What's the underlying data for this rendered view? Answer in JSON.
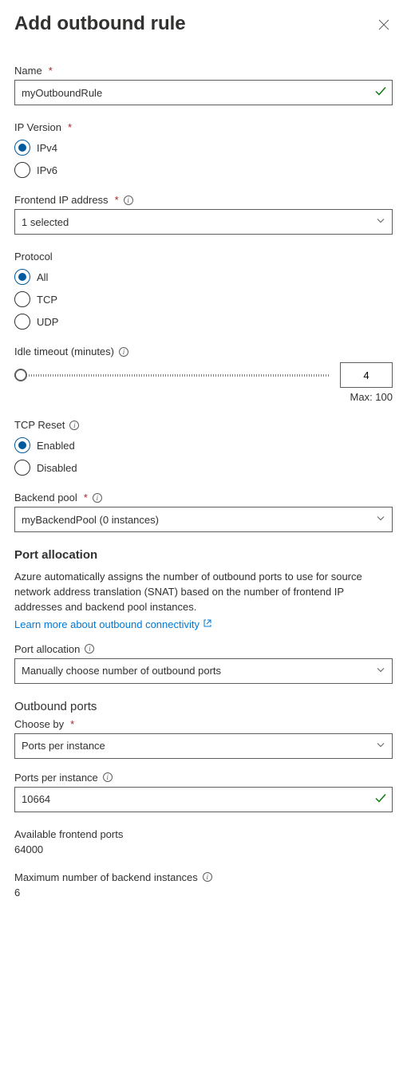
{
  "header": {
    "title": "Add outbound rule"
  },
  "name": {
    "label": "Name",
    "value": "myOutboundRule"
  },
  "ipVersion": {
    "label": "IP Version",
    "options": [
      "IPv4",
      "IPv6"
    ],
    "selected": "IPv4"
  },
  "frontendIp": {
    "label": "Frontend IP address",
    "value": "1 selected"
  },
  "protocol": {
    "label": "Protocol",
    "options": [
      "All",
      "TCP",
      "UDP"
    ],
    "selected": "All"
  },
  "idleTimeout": {
    "label": "Idle timeout (minutes)",
    "value": "4",
    "maxLabel": "Max: 100"
  },
  "tcpReset": {
    "label": "TCP Reset",
    "options": [
      "Enabled",
      "Disabled"
    ],
    "selected": "Enabled"
  },
  "backendPool": {
    "label": "Backend pool",
    "value": "myBackendPool (0 instances)"
  },
  "portAllocationSection": {
    "heading": "Port allocation",
    "description": "Azure automatically assigns the number of outbound ports to use for source network address translation (SNAT) based on the number of frontend IP addresses and backend pool instances.",
    "linkText": "Learn more about outbound connectivity"
  },
  "portAllocation": {
    "label": "Port allocation",
    "value": "Manually choose number of outbound ports"
  },
  "outboundPorts": {
    "heading": "Outbound ports",
    "chooseByLabel": "Choose by",
    "chooseByValue": "Ports per instance"
  },
  "portsPerInstance": {
    "label": "Ports per instance",
    "value": "10664"
  },
  "availableFrontendPorts": {
    "label": "Available frontend ports",
    "value": "64000"
  },
  "maxBackendInstances": {
    "label": "Maximum number of backend instances",
    "value": "6"
  }
}
